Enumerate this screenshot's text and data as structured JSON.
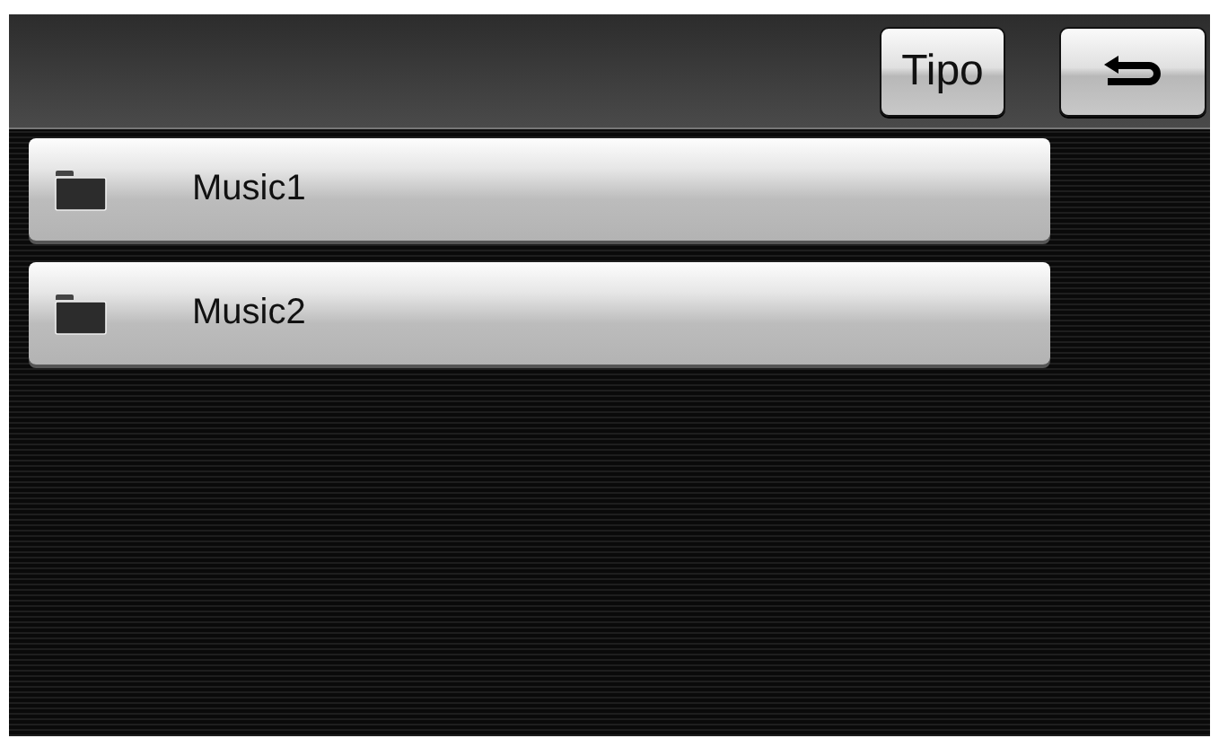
{
  "toolbar": {
    "type_button": "Tipo"
  },
  "folders": [
    {
      "name": "Music1"
    },
    {
      "name": "Music2"
    }
  ]
}
